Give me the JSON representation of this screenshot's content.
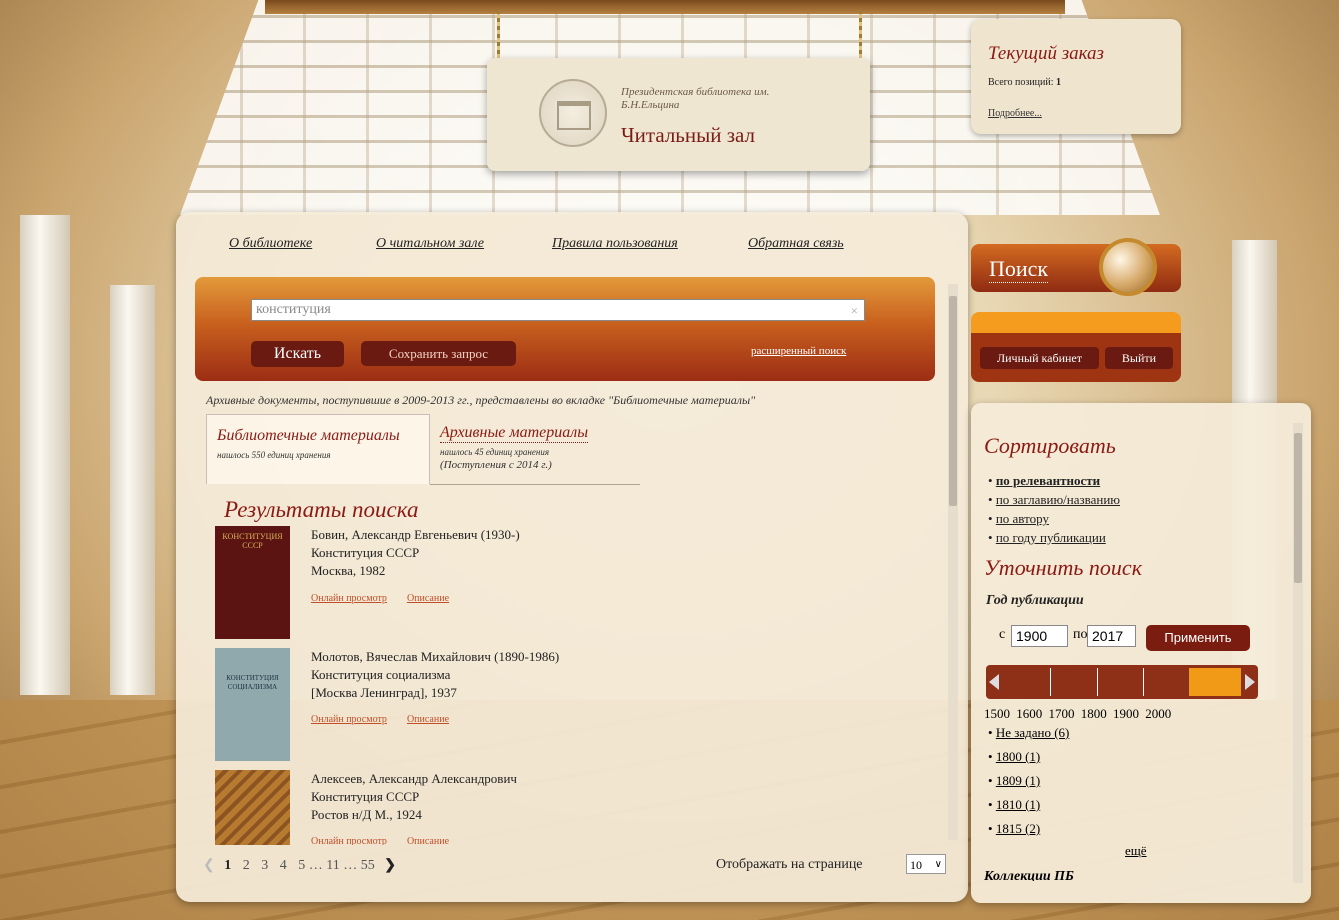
{
  "header": {
    "library_name": "Президентская библиотека им. Б.Н.Ельцина",
    "title": "Читальный зал"
  },
  "order": {
    "title": "Текущий заказ",
    "count_label": "Всего позиций:",
    "count": "1",
    "details_link": "Подробнее..."
  },
  "nav": [
    "О библиотеке",
    "О читальном зале",
    "Правила пользования",
    "Обратная связь"
  ],
  "search": {
    "query": "конституция",
    "clear_icon": "×",
    "submit_label": "Искать",
    "save_label": "Сохранить запрос",
    "advanced_label": "расширенный поиск"
  },
  "notice": "Архивные документы, поступившие в 2009-2013 гг., представлены во вкладке \"Библиотечные материалы\"",
  "tabs": [
    {
      "label": "Библиотечные материалы",
      "count": "нашлось 550 единиц хранения",
      "note": ""
    },
    {
      "label": "Архивные материалы",
      "count": "нашлось 45 единиц хранения",
      "note": "(Поступления с 2014 г.)"
    }
  ],
  "results_title": "Результаты поиска",
  "results": [
    {
      "author": "Бовин, Александр Евгеньевич (1930-)",
      "title": "Конституция СССР",
      "place": "Москва, 1982",
      "online": "Онлайн просмотр",
      "desc": "Описание",
      "cover_color": "#5b1412"
    },
    {
      "author": "Молотов, Вячеслав Михайлович (1890-1986)",
      "title": "Конституция социализма",
      "place": "[Москва Ленинград], 1937",
      "online": "Онлайн просмотр",
      "desc": "Описание",
      "cover_color": "#8fa9ad"
    },
    {
      "author": "Алексеев, Александр Александрович",
      "title": "Конституция СССР",
      "place": "Ростов н/Д М., 1924",
      "online": "Онлайн просмотр",
      "desc": "Описание",
      "cover_color": "#b67a30"
    }
  ],
  "pager": {
    "prev": "❮",
    "pages": [
      "1",
      "2",
      "3",
      "4",
      "5 … 11 … 55"
    ],
    "next": "❯",
    "per_page_label": "Отображать на странице",
    "per_page_value": "10"
  },
  "side": {
    "search_label": "Поиск",
    "cabinet_label": "Личный кабинет",
    "logout_label": "Выйти",
    "sort_title": "Сортировать",
    "sort_options": [
      "по релевантности",
      "по заглавию/названию",
      "по автору",
      "по году публикации"
    ],
    "refine_title": "Уточнить поиск",
    "year_title": "Год публикации",
    "from_label": "с",
    "from_value": "1900",
    "to_label": "по",
    "to_value": "2017",
    "apply_label": "Применить",
    "ticks": [
      "1500",
      "1600",
      "1700",
      "1800",
      "1900",
      "2000"
    ],
    "years": [
      "Не задано (6)",
      "1800 (1)",
      "1809 (1)",
      "1810 (1)",
      "1815 (2)"
    ],
    "more_label": "ещё",
    "collections_title": "Коллекции ПБ"
  }
}
